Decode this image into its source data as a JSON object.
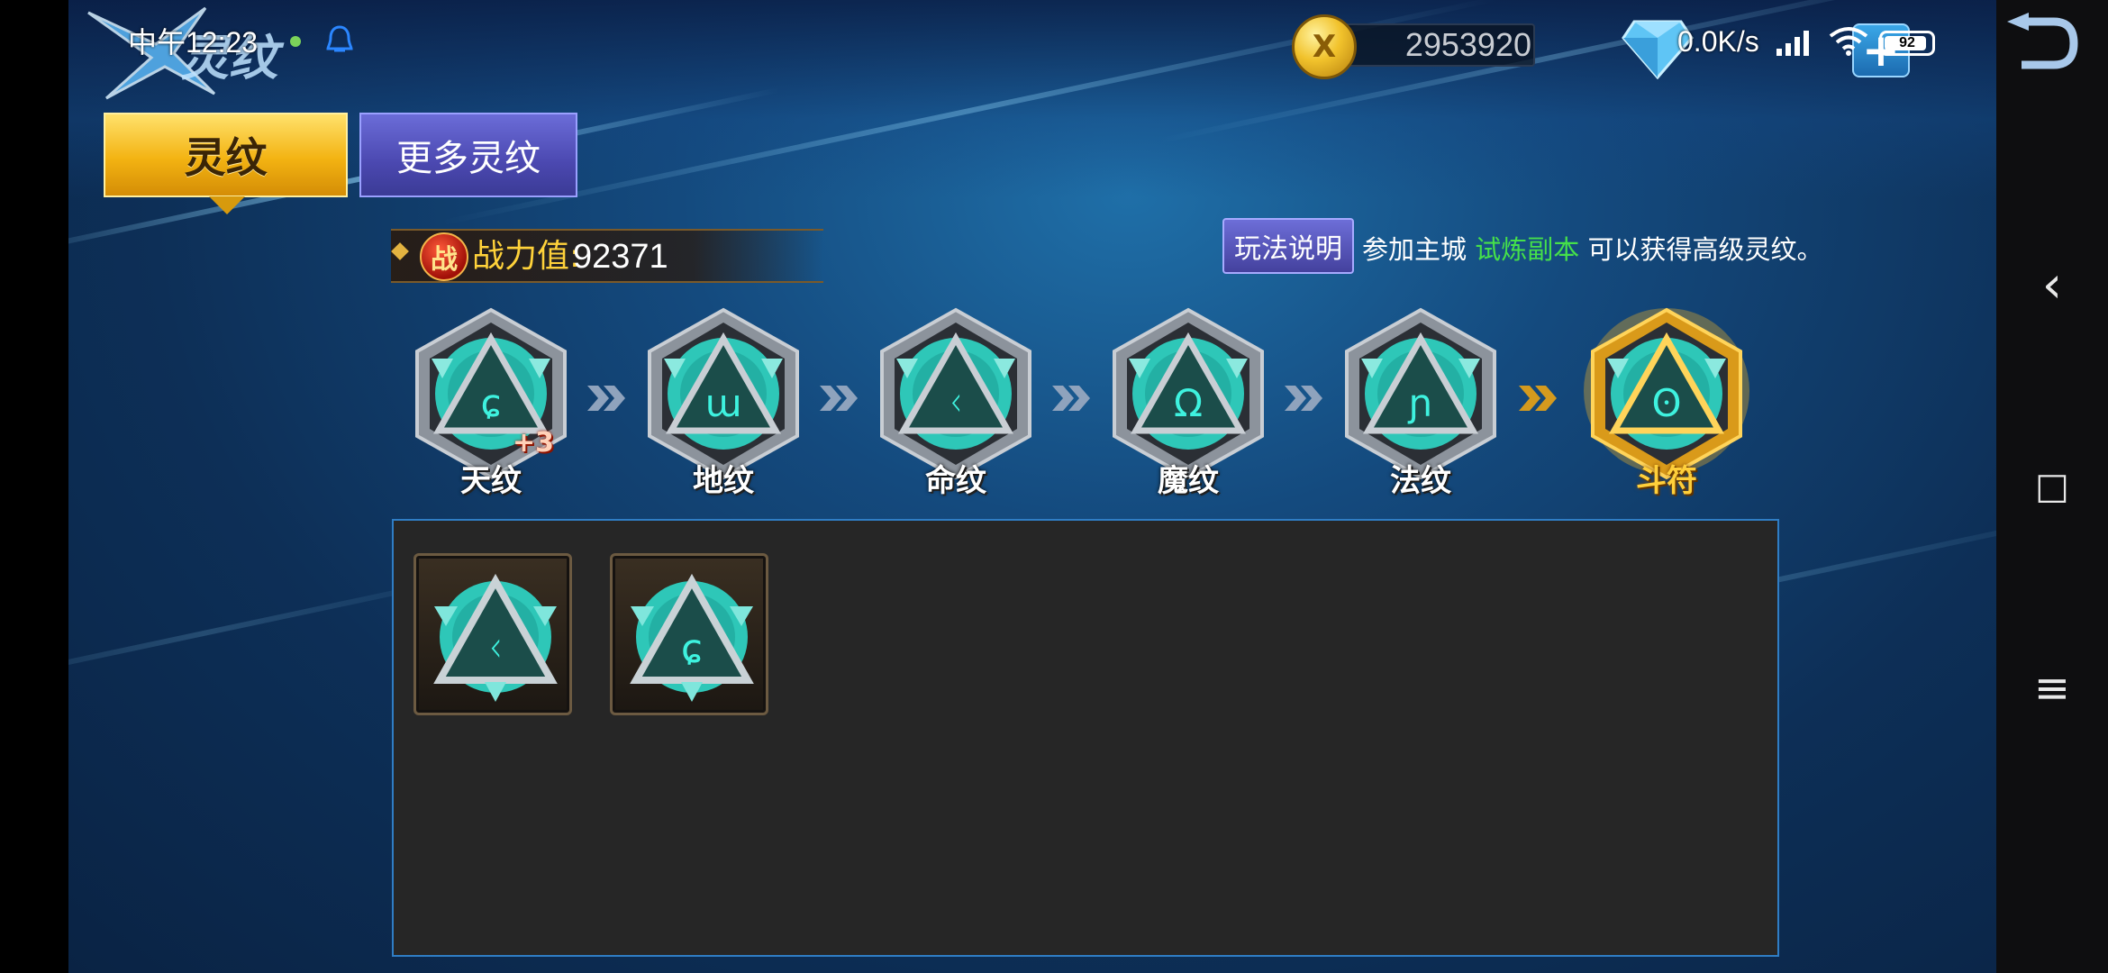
{
  "status_bar": {
    "time": "中午12:23",
    "net_speed": "0.0K/s",
    "battery": "92",
    "battery_level": 0.92
  },
  "header": {
    "title": "灵纹",
    "gold": "2953920",
    "coin_glyph": "X",
    "add_glyph": "+"
  },
  "tabs": [
    {
      "label": "灵纹",
      "active": true
    },
    {
      "label": "更多灵纹",
      "active": false
    }
  ],
  "power": {
    "badge": "战",
    "label": "战力值:",
    "value": "92371"
  },
  "help": {
    "button_label": "玩法说明",
    "text_before": "参加主城 ",
    "highlight": "试炼副本",
    "text_after": " 可以获得高级灵纹。",
    "highlight_color": "#45e04a"
  },
  "runes": [
    {
      "name": "天纹",
      "bonus": "+3",
      "tier": "silver",
      "glyph": "ɕ"
    },
    {
      "name": "地纹",
      "tier": "silver",
      "glyph": "ɯ"
    },
    {
      "name": "命纹",
      "tier": "silver",
      "glyph": "ᚲ"
    },
    {
      "name": "魔纹",
      "tier": "silver",
      "glyph": "Ω"
    },
    {
      "name": "法纹",
      "tier": "silver",
      "glyph": "ɲ"
    },
    {
      "name": "斗符",
      "tier": "gold",
      "glyph": "ʘ"
    }
  ],
  "inventory": {
    "items": [
      {
        "icon": "ming-rune-icon",
        "glyph": "ᚲ"
      },
      {
        "icon": "tian-rune-icon",
        "glyph": "ɕ"
      }
    ]
  },
  "nav": {
    "back": "‹",
    "home": "□",
    "menu": "≡"
  },
  "colors": {
    "accent_gold": "#f3b312",
    "tab_inactive": "#4b48b0",
    "rune_teal": "#31d0c0",
    "inventory_border": "#2f7dc4"
  }
}
